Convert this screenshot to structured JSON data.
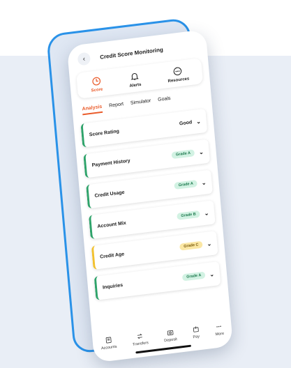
{
  "header": {
    "title": "Credit Score Monitoring"
  },
  "icon_tabs": [
    {
      "label": "Score",
      "icon": "score-icon",
      "active": true
    },
    {
      "label": "Alerts",
      "icon": "bell-icon",
      "active": false
    },
    {
      "label": "Resources",
      "icon": "resources-icon",
      "active": false
    }
  ],
  "sub_tabs": [
    {
      "label": "Analysis",
      "active": true
    },
    {
      "label": "Report",
      "active": false
    },
    {
      "label": "Simulator",
      "active": false
    },
    {
      "label": "Goals",
      "active": false
    }
  ],
  "cards": [
    {
      "label": "Score Rating",
      "value": "Good",
      "status": "plain"
    },
    {
      "label": "Payment History",
      "value": "Grade A",
      "status": "good"
    },
    {
      "label": "Credit Usage",
      "value": "Grade A",
      "status": "good"
    },
    {
      "label": "Account Mix",
      "value": "Grade B",
      "status": "good"
    },
    {
      "label": "Credit Age",
      "value": "Grade C",
      "status": "warn"
    },
    {
      "label": "Inquiries",
      "value": "Grade A",
      "status": "good"
    }
  ],
  "bottom_nav": [
    {
      "label": "Accounts",
      "icon": "accounts-icon"
    },
    {
      "label": "Transfers",
      "icon": "transfers-icon"
    },
    {
      "label": "Deposit",
      "icon": "deposit-icon"
    },
    {
      "label": "Pay",
      "icon": "pay-icon"
    },
    {
      "label": "More",
      "icon": "more-icon"
    }
  ],
  "colors": {
    "accent": "#ea5b2a",
    "frame": "#2a92e8",
    "good": "#2ea36a",
    "warn": "#f2c12e"
  }
}
